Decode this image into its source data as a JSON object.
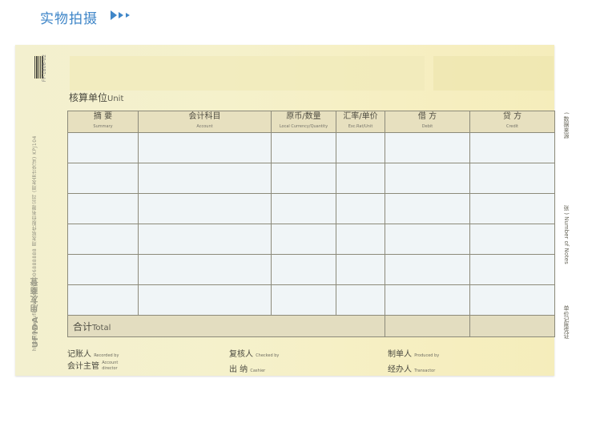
{
  "header": {
    "title": "实物拍摄"
  },
  "voucher": {
    "barcode_code": "FP-1806-02",
    "side_text": "http://www.ufidaoa.com     4006888888     用友软件股份有限公司 (用友会计凭证)     KPJ104",
    "brand": "UFIDA 用友商登",
    "unit_cn": "核算单位",
    "unit_en": "Unit",
    "columns": [
      {
        "cn": "摘  要",
        "en": "Summary"
      },
      {
        "cn": "会计科目",
        "en": "Account"
      },
      {
        "cn": "原币/数量",
        "en": "Local Currency/Quantity"
      },
      {
        "cn": "汇率/单价",
        "en": "Exc.Rat/Unit"
      },
      {
        "cn": "借  方",
        "en": "Debit"
      },
      {
        "cn": "贷  方",
        "en": "Credit"
      }
    ],
    "total_cn": "合计",
    "total_en": "Total",
    "right_side_top": "( 数据来源",
    "right_side_mid": "张 ) Number of Notes",
    "right_side_bottom": "单价记账凭证",
    "footer": {
      "recorded_cn": "记账人",
      "recorded_en": "Recorded by",
      "checked_cn": "复核人",
      "checked_en": "Checked by",
      "produced_cn": "制单人",
      "produced_en": "Produced by",
      "director_cn": "会计主管",
      "director_en_1": "Account",
      "director_en_2": "director",
      "cashier_cn": "出  纳",
      "cashier_en": "Cashier",
      "transactor_cn": "经办人",
      "transactor_en": "Transactor"
    }
  },
  "colors": {
    "header_blue": "#3f86c8",
    "paper": "#f4efc6",
    "table_header": "#e7e0bf",
    "table_body": "#f0f5f7"
  }
}
